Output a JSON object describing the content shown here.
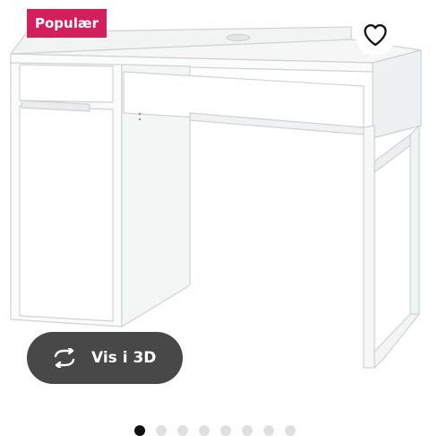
{
  "badge": {
    "label": "Populær",
    "color": "#d31f5b"
  },
  "favorite": {
    "icon": "heart-outline-icon"
  },
  "view3d": {
    "label": "Vis i 3D",
    "icon": "rotate-arrows-icon"
  },
  "carousel": {
    "total": 8,
    "active_index": 0
  },
  "product_image": {
    "subject": "white desk with drawer and cabinet"
  }
}
